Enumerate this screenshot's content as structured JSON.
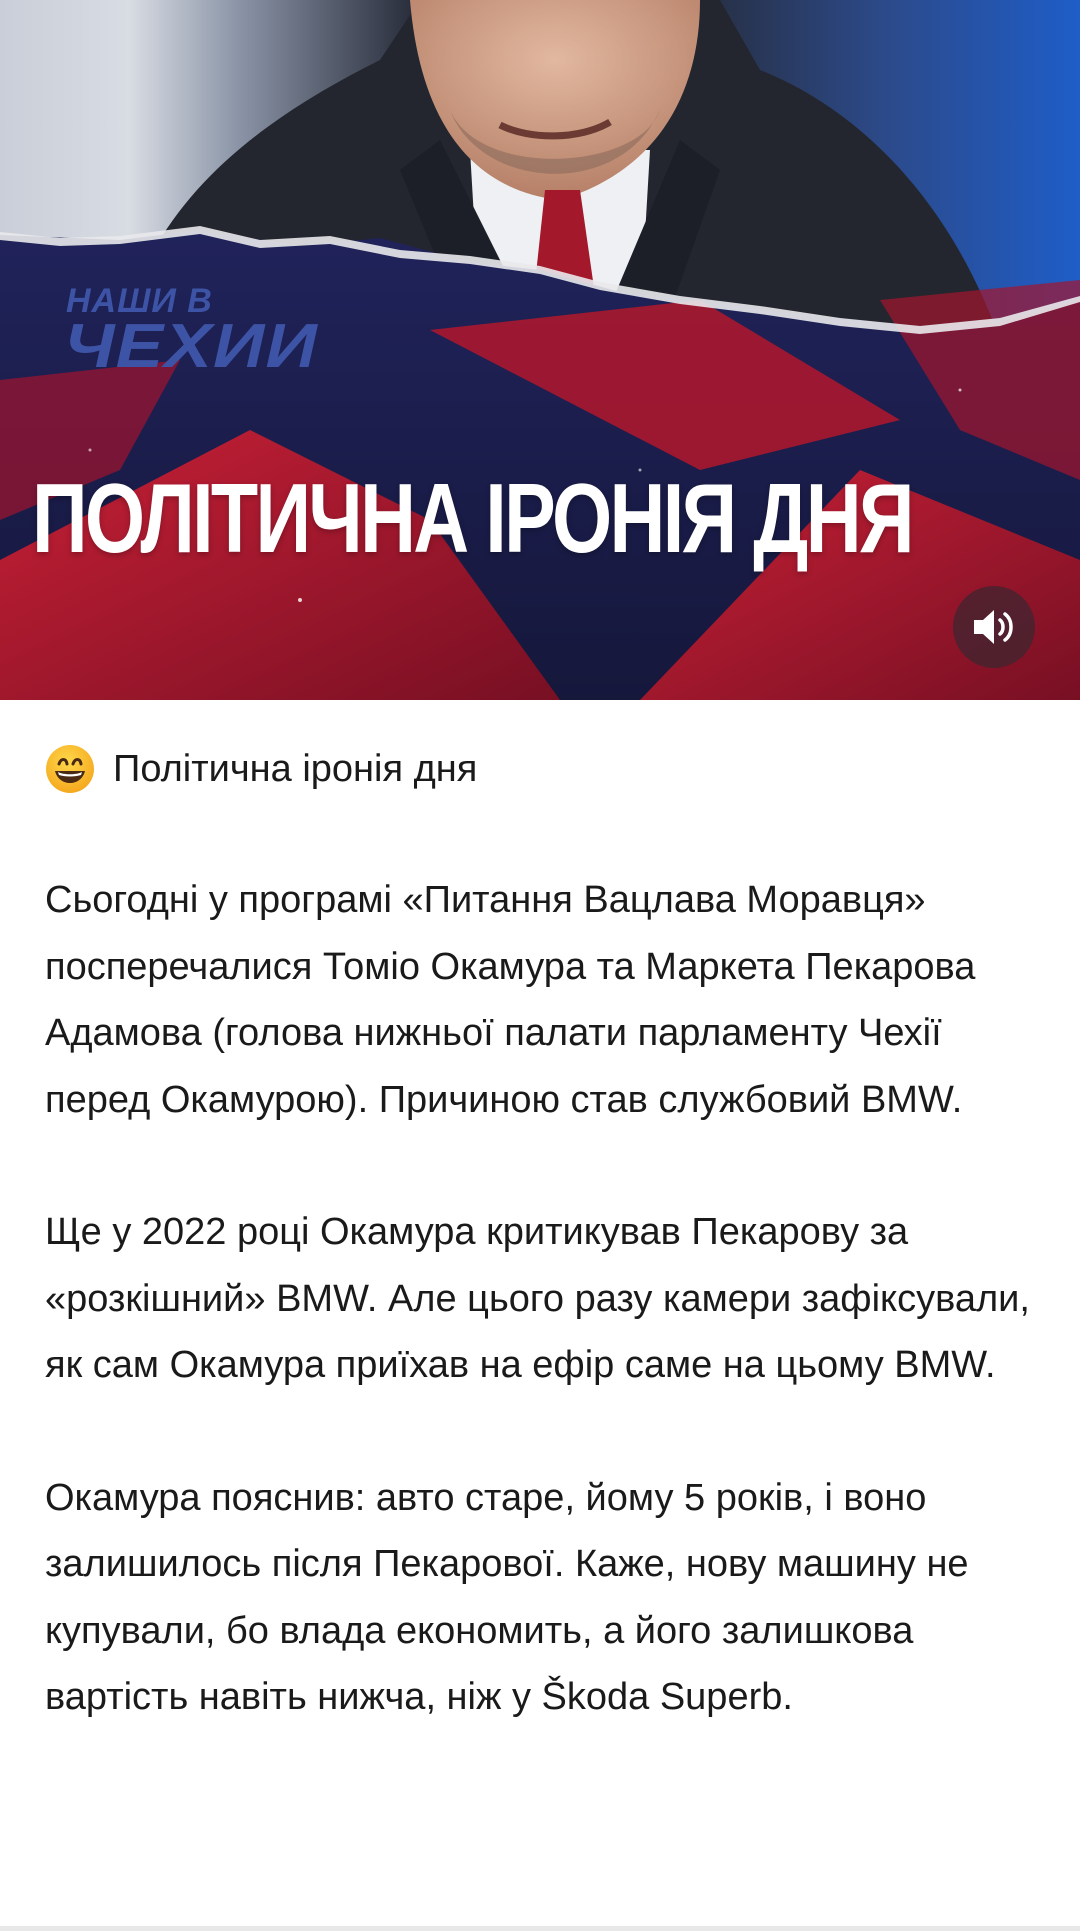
{
  "media": {
    "brand_logo": {
      "line_1": "НАШИ В",
      "line_2": "ЧЕХИИ"
    },
    "headline": "ПОЛІТИЧНА ІРОНІЯ ДНЯ",
    "sound_icon": "speaker-volume-icon",
    "colors": {
      "navy": "#1b1d46",
      "red": "#c0182a",
      "logo_blue": "#3d54a6"
    }
  },
  "post": {
    "title_emoji": "grinning-face-emoji",
    "title": "Політична іронія дня",
    "paragraphs": [
      "Сьогодні у програмі «Питання Вацлава Моравця» посперечалися Томіо Окамура та Маркета Пекарова Адамова (голова нижньої палати парламенту Чехії перед Окамурою). Причиною став службовий BMW.",
      "Ще у 2022 році Окамура критикував Пекарову за «розкішний» BMW. Але цього разу камери зафіксували, як сам Окамура приїхав на ефір саме на цьому BMW.",
      "Окамура пояснив: авто старе, йому 5 років, і воно залишилось після Пекарової. Каже, нову машину не купували, бо влада економить, а його залишкова вартість навіть нижча, ніж у Škoda Superb."
    ]
  }
}
